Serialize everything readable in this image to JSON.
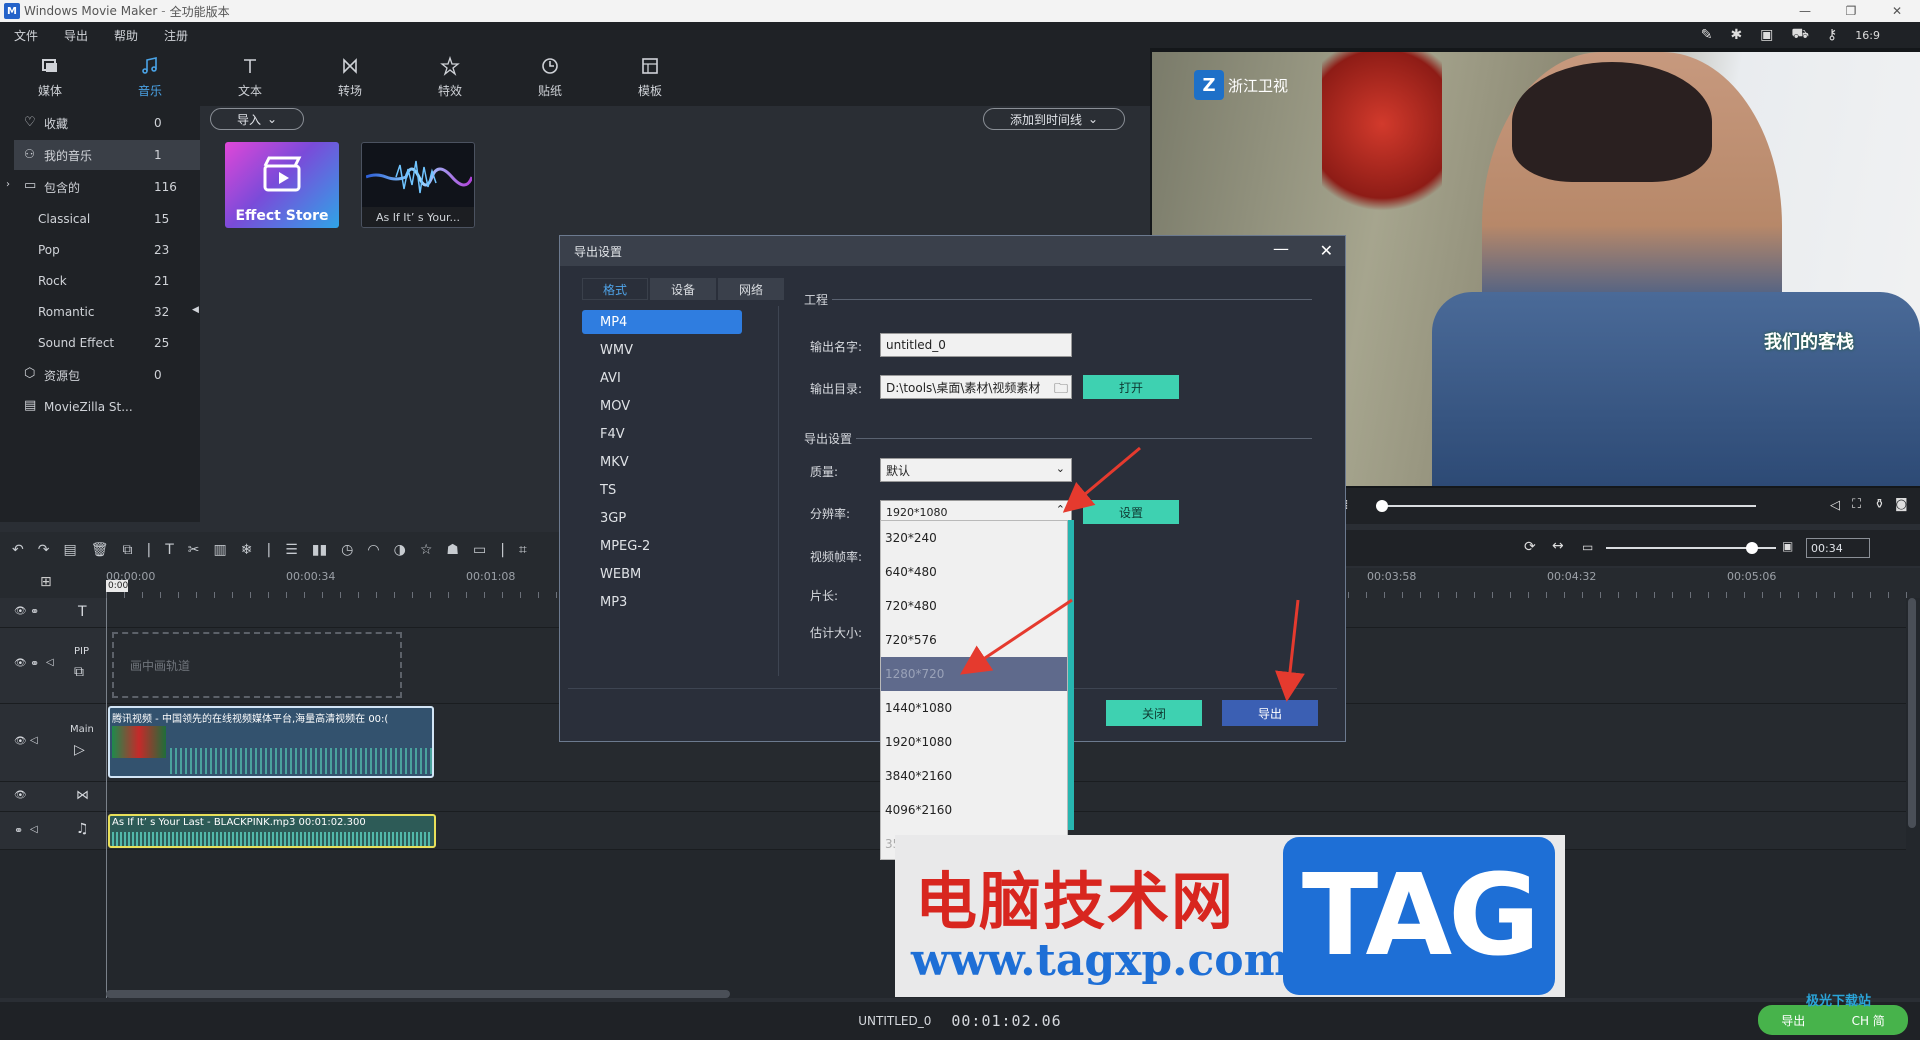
{
  "app": {
    "title": "Windows Movie Maker",
    "edition": "全功能版本"
  },
  "menu": [
    "文件",
    "导出",
    "帮助",
    "注册"
  ],
  "tabs": [
    {
      "label": "媒体",
      "icon": "media-icon"
    },
    {
      "label": "音乐",
      "icon": "music-icon",
      "active": true
    },
    {
      "label": "文本",
      "icon": "text-icon"
    },
    {
      "label": "转场",
      "icon": "transition-icon"
    },
    {
      "label": "特效",
      "icon": "effects-icon"
    },
    {
      "label": "贴纸",
      "icon": "sticker-icon"
    },
    {
      "label": "模板",
      "icon": "template-icon"
    }
  ],
  "sidebar": {
    "items": [
      {
        "label": "收藏",
        "count": "0"
      },
      {
        "label": "我的音乐",
        "count": "1"
      },
      {
        "label": "包含的",
        "count": "116"
      },
      {
        "label": "Classical",
        "count": "15"
      },
      {
        "label": "Pop",
        "count": "23"
      },
      {
        "label": "Rock",
        "count": "21"
      },
      {
        "label": "Romantic",
        "count": "32"
      },
      {
        "label": "Sound Effect",
        "count": "25"
      },
      {
        "label": "资源包",
        "count": "0"
      },
      {
        "label": "MovieZilla St...",
        "count": ""
      }
    ]
  },
  "library": {
    "import_label": "导入",
    "add_to_timeline_label": "添加到时间线",
    "items": [
      {
        "caption": "Effect Store"
      },
      {
        "caption": "As If It’ s Your..."
      }
    ]
  },
  "preview": {
    "channel_text": "浙江卫视",
    "show_logo_text": "我们的客栈",
    "time_value": "00:34"
  },
  "timeline": {
    "ruler": [
      "00:00:00",
      "00:00:34",
      "00:01:08",
      "00:03:58",
      "00:04:32",
      "00:05:06"
    ],
    "playhead_label": "0:00",
    "tracks": {
      "pip_label": "PIP",
      "pip_placeholder": "画中画轨道",
      "main_label": "Main",
      "video_clip": "腾讯视频 - 中国领先的在线视频媒体平台,海量高清视频在 00:(",
      "audio_clip": "As If It’ s Your Last - BLACKPINK.mp3   00:01:02.300"
    }
  },
  "status": {
    "project": "UNTITLED_0",
    "timecode": "00:01:02.06"
  },
  "dialog": {
    "title": "导出设置",
    "tabs": [
      "格式",
      "设备",
      "网络"
    ],
    "formats": [
      "MP4",
      "WMV",
      "AVI",
      "MOV",
      "F4V",
      "MKV",
      "TS",
      "3GP",
      "MPEG-2",
      "WEBM",
      "MP3"
    ],
    "section_project": "工程",
    "output_name_label": "输出名字:",
    "output_name_value": "untitled_0",
    "output_dir_label": "输出目录:",
    "output_dir_value": "D:\\tools\\桌面\\素材\\视频素材",
    "open_button": "打开",
    "section_export": "导出设置",
    "quality_label": "质量:",
    "quality_value": "默认",
    "resolution_label": "分辨率:",
    "resolution_value": "1920*1080",
    "settings_button": "设置",
    "framerate_label": "视频帧率:",
    "duration_label": "片长:",
    "size_label": "估计大小:",
    "close_button": "关闭",
    "export_button": "导出"
  },
  "resolution_options": [
    "320*240",
    "640*480",
    "720*480",
    "720*576",
    "1280*720",
    "1440*1080",
    "1920*1080",
    "3840*2160",
    "4096*2160",
    "352*288"
  ],
  "watermark": {
    "cn": "电脑技术网",
    "url": "www.tagxp.com",
    "tag": "TAG"
  },
  "corner": {
    "text1": "极光下载站",
    "text2": "CH 简",
    "export_label": "导出"
  },
  "colors": {
    "accent": "#4aa3e6",
    "green_button": "#3ed1b1",
    "export_button": "#3b5fb3",
    "selected_format": "#2f7de0"
  }
}
